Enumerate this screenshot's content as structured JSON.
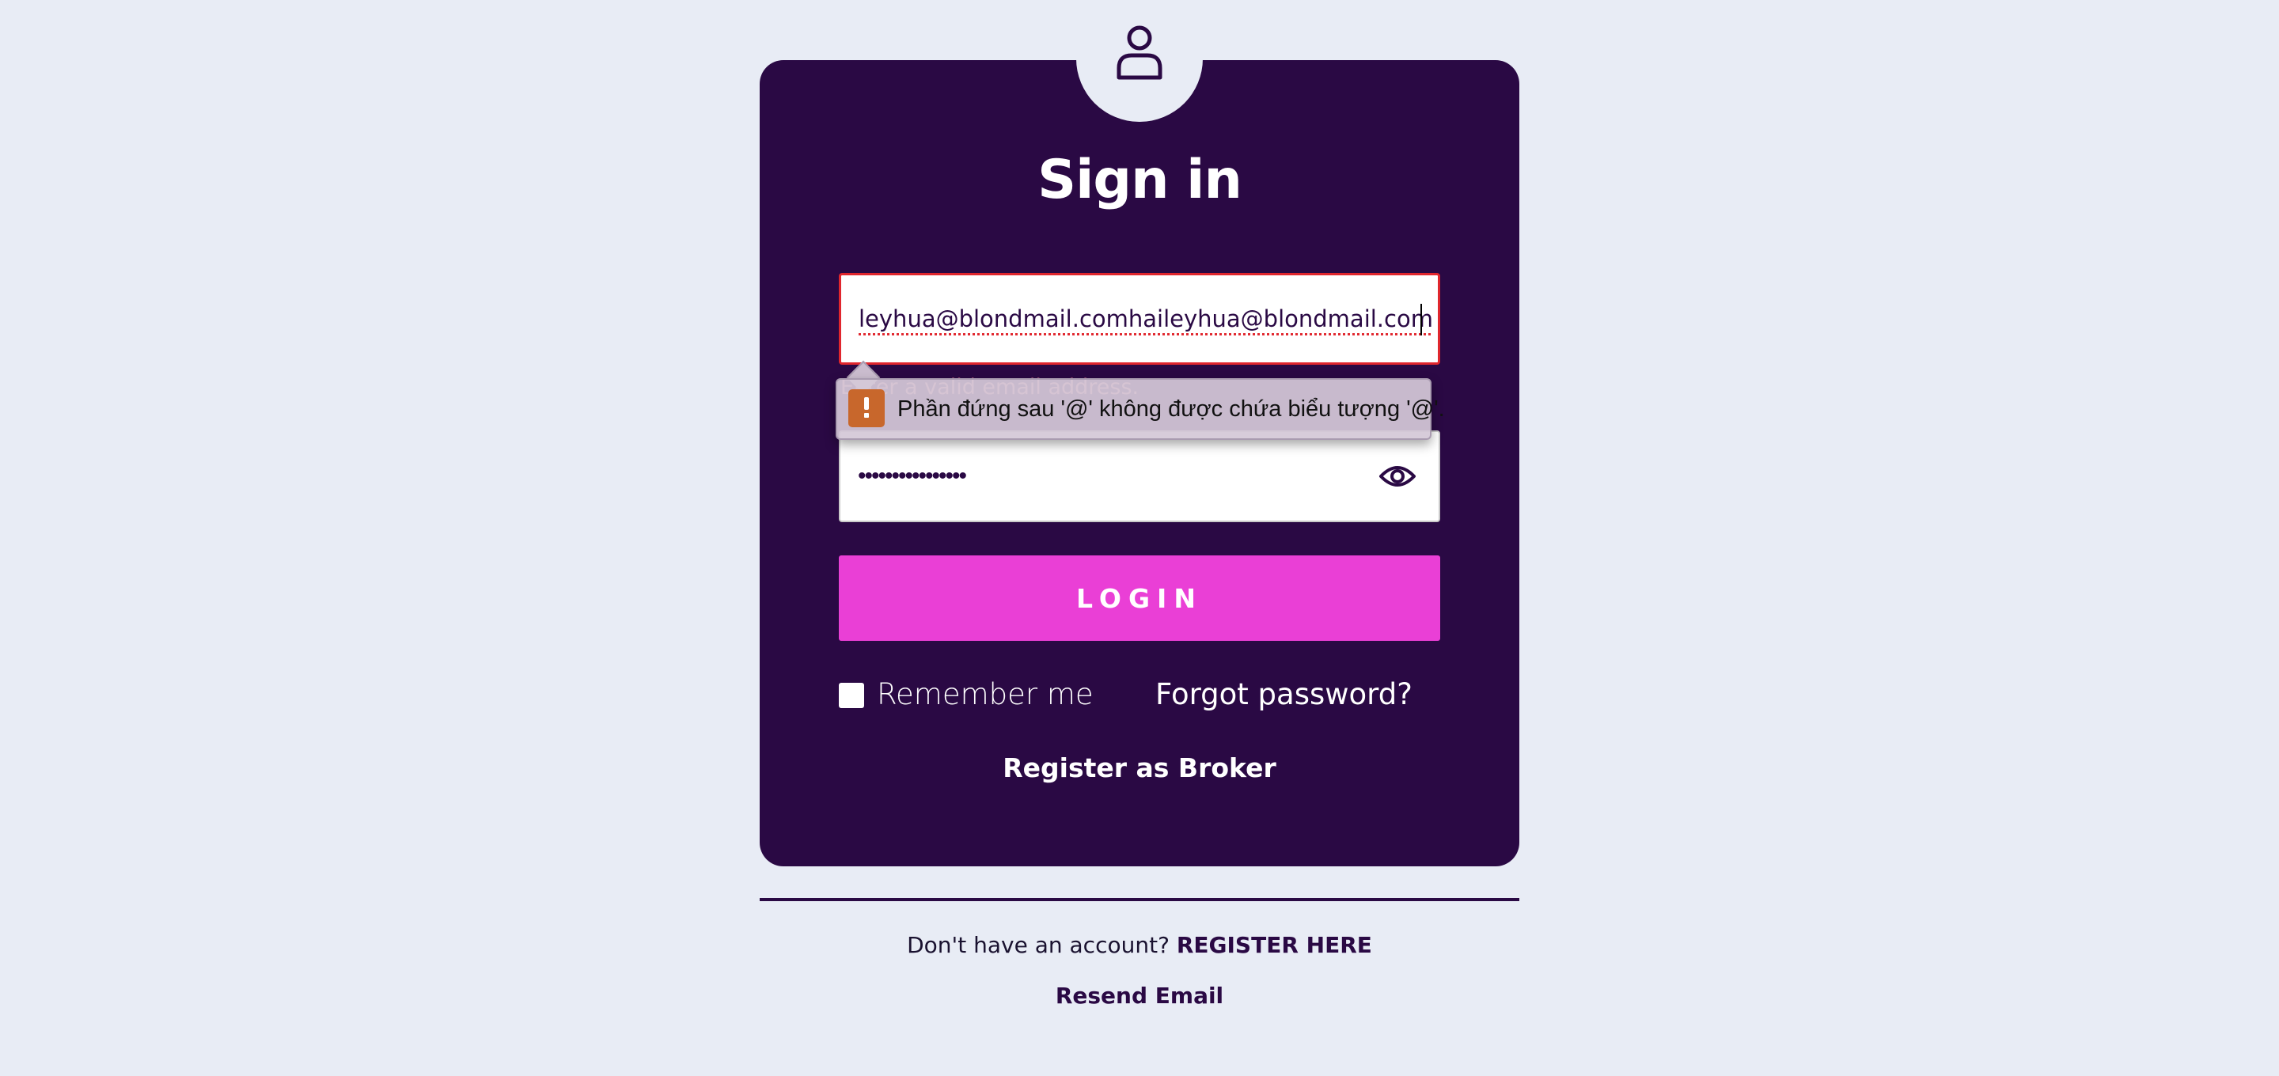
{
  "colors": {
    "background": "#e8ecf5",
    "card": "#2a0944",
    "accent_button": "#ea3fd6",
    "error": "#e0262d",
    "error_text": "#f08a9c",
    "tooltip_warning": "#c8672c"
  },
  "header": {
    "avatar_icon": "user-icon",
    "title": "Sign in"
  },
  "form": {
    "email_value": "leyhua@blondmail.comhaileyhua@blondmail.com",
    "email_error": "Enter a valid email address.",
    "password_value": "••••••••••••••••",
    "password_toggle_icon": "eye-icon",
    "login_label": "LOGIN",
    "remember_label": "Remember me",
    "forgot_label": "Forgot password?",
    "register_broker_label": "Register as Broker"
  },
  "validation_tooltip": {
    "icon": "warning-icon",
    "message": "Phần đứng sau '@' không được chứa biểu tượng '@'."
  },
  "footer": {
    "no_account_text": "Don't have an account?",
    "register_here_label": "REGISTER HERE",
    "resend_label": "Resend Email"
  }
}
